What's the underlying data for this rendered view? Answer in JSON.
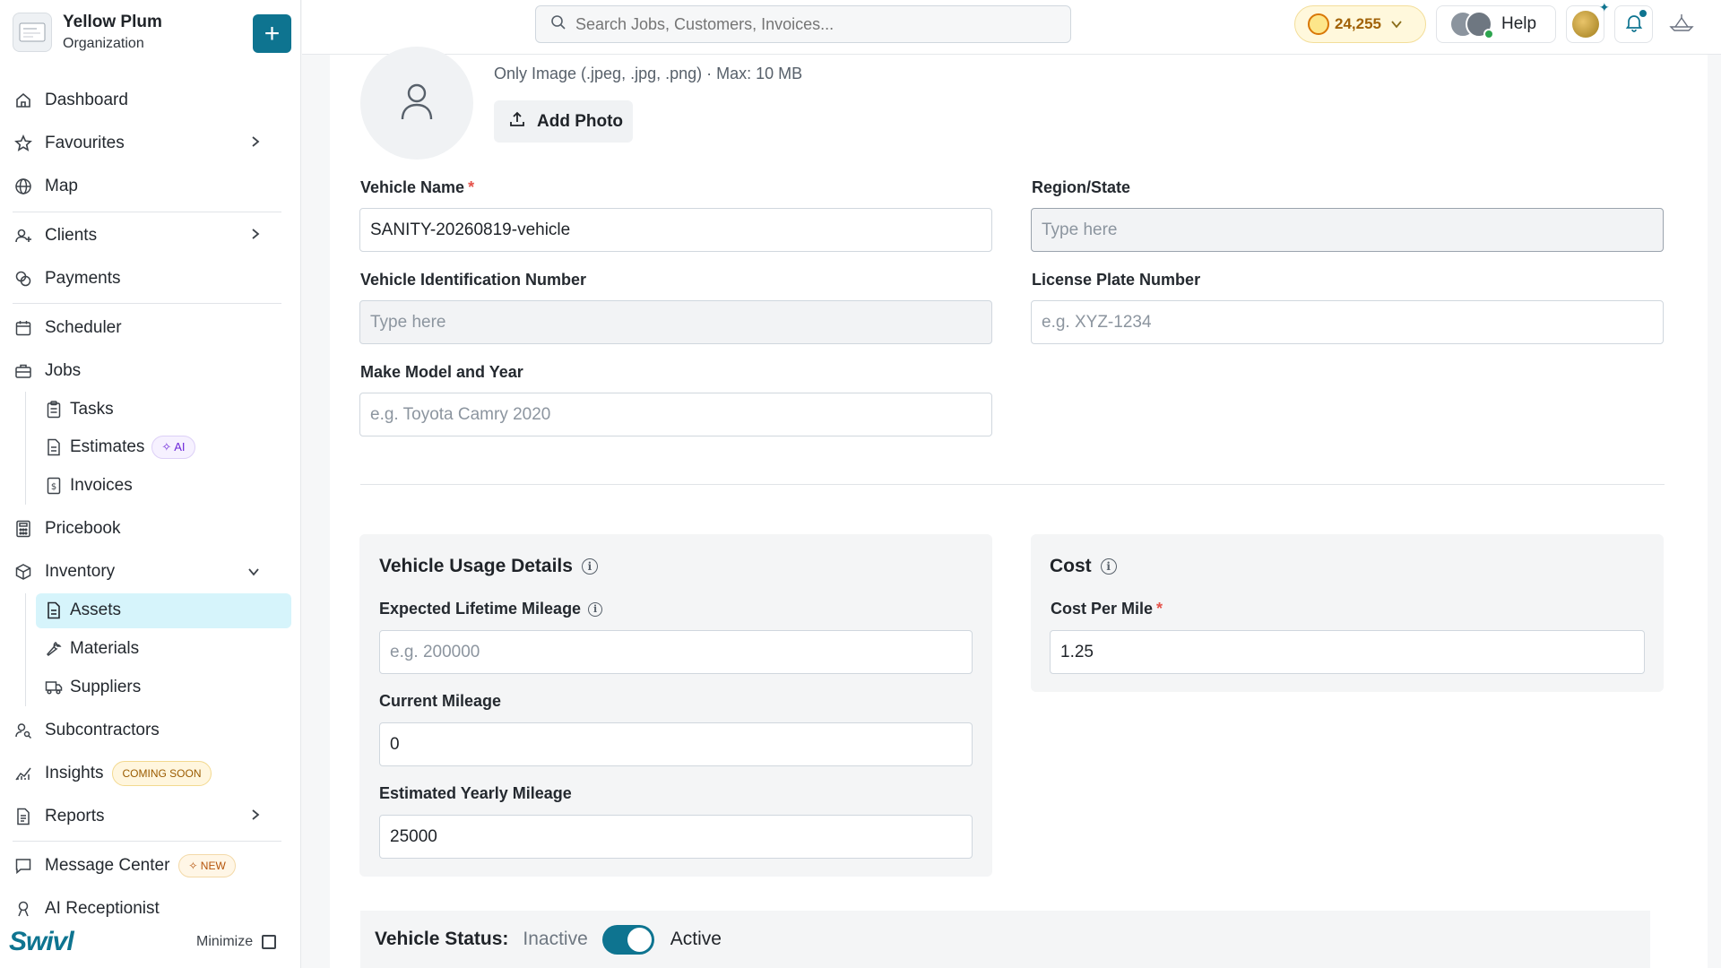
{
  "org": {
    "name": "Yellow Plum",
    "subtitle": "Organization",
    "add_label": "+"
  },
  "nav": {
    "dashboard": "Dashboard",
    "favourites": "Favourites",
    "map": "Map",
    "clients": "Clients",
    "payments": "Payments",
    "scheduler": "Scheduler",
    "jobs": "Jobs",
    "tasks": "Tasks",
    "estimates": "Estimates",
    "estimates_badge": "✧ AI",
    "invoices": "Invoices",
    "pricebook": "Pricebook",
    "inventory": "Inventory",
    "assets": "Assets",
    "materials": "Materials",
    "suppliers": "Suppliers",
    "subcontractors": "Subcontractors",
    "insights": "Insights",
    "insights_badge": "COMING SOON",
    "reports": "Reports",
    "message_center": "Message Center",
    "message_center_badge": "✧ NEW",
    "ai_receptionist": "AI Receptionist",
    "brand": "Swivl",
    "minimize": "Minimize"
  },
  "topbar": {
    "search_placeholder": "Search Jobs, Customers, Invoices...",
    "coins": "24,255",
    "help": "Help"
  },
  "form": {
    "image_hint": "Only Image (.jpeg, .jpg, .png) · Max: 10 MB",
    "add_photo": "Add Photo",
    "vehicle_name_label": "Vehicle Name",
    "required_mark": "*",
    "vehicle_name_value": "SANITY-20260819-vehicle",
    "region_label": "Region/State",
    "region_placeholder": "Type here",
    "vin_label": "Vehicle Identification Number",
    "vin_placeholder": "Type here",
    "plate_label": "License Plate Number",
    "plate_placeholder": "e.g. XYZ-1234",
    "make_label": "Make Model and Year",
    "make_placeholder": "e.g. Toyota Camry 2020"
  },
  "usage": {
    "title": "Vehicle Usage Details",
    "lifetime_label": "Expected Lifetime Mileage",
    "lifetime_placeholder": "e.g. 200000",
    "current_label": "Current Mileage",
    "current_value": "0",
    "yearly_label": "Estimated Yearly Mileage",
    "yearly_value": "25000"
  },
  "cost": {
    "title": "Cost",
    "per_mile_label": "Cost Per Mile",
    "per_mile_value": "1.25"
  },
  "status": {
    "label": "Vehicle Status:",
    "inactive": "Inactive",
    "active": "Active",
    "is_active": true
  },
  "colors": {
    "accent": "#0e7490",
    "active_nav_bg": "#d6f4fb",
    "required": "#e5534b"
  }
}
